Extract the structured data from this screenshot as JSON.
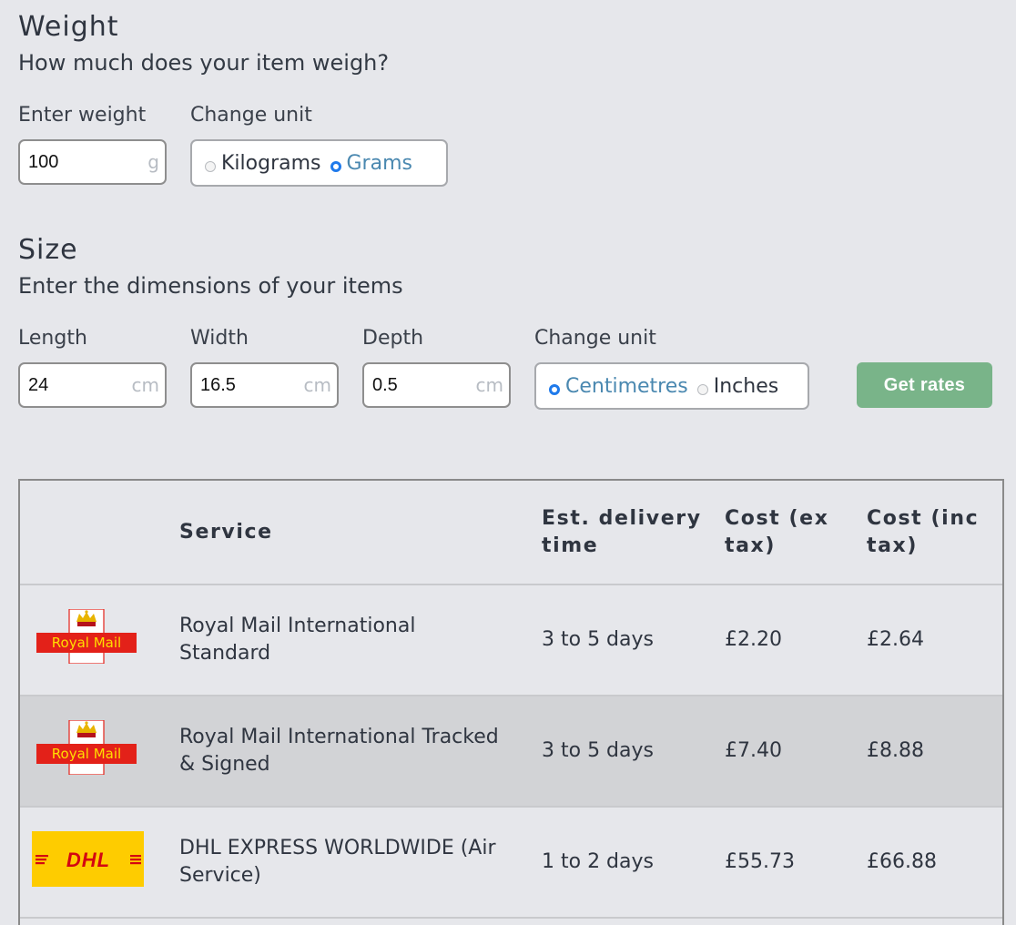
{
  "weight": {
    "title": "Weight",
    "subtitle": "How much does your item weigh?",
    "enter_label": "Enter weight",
    "value": "100",
    "unit_suffix": "g",
    "change_unit_label": "Change unit",
    "units": [
      {
        "label": "Kilograms",
        "checked": false
      },
      {
        "label": "Grams",
        "checked": true
      }
    ]
  },
  "size": {
    "title": "Size",
    "subtitle": "Enter the dimensions of your items",
    "length": {
      "label": "Length",
      "value": "24",
      "unit": "cm"
    },
    "width": {
      "label": "Width",
      "value": "16.5",
      "unit": "cm"
    },
    "depth": {
      "label": "Depth",
      "value": "0.5",
      "unit": "cm"
    },
    "change_unit_label": "Change unit",
    "units": [
      {
        "label": "Centimetres",
        "checked": true
      },
      {
        "label": "Inches",
        "checked": false
      }
    ]
  },
  "get_rates_label": "Get rates",
  "colors": {
    "button": "#79b489",
    "radio_checked": "#1f7aeb",
    "active_unit_text": "#4a88b0",
    "royal_mail_red": "#e32119",
    "dhl_yellow": "#fecc00",
    "dhl_red": "#d40511"
  },
  "table": {
    "headers": {
      "service": "Service",
      "delivery_line1": "Est. delivery",
      "delivery_line2": "time",
      "cost_ex_line1": "Cost (ex",
      "cost_ex_line2": "tax)",
      "cost_inc_line1": "Cost (inc",
      "cost_inc_line2": "tax)"
    },
    "rows": [
      {
        "logo": "royal-mail-logo",
        "logo_text": "Royal Mail",
        "service_line1": "Royal Mail International",
        "service_line2": "Standard",
        "delivery": "3 to 5 days",
        "cost_ex": "£2.20",
        "cost_inc": "£2.64"
      },
      {
        "logo": "royal-mail-logo",
        "logo_text": "Royal Mail",
        "service_line1": "Royal Mail International Tracked",
        "service_line2": "& Signed",
        "delivery": "3 to 5 days",
        "cost_ex": "£7.40",
        "cost_inc": "£8.88"
      },
      {
        "logo": "dhl-logo",
        "logo_text": "DHL",
        "service_line1": "DHL EXPRESS WORLDWIDE (Air",
        "service_line2": "Service)",
        "delivery": "1 to 2 days",
        "cost_ex": "£55.73",
        "cost_inc": "£66.88"
      }
    ]
  }
}
